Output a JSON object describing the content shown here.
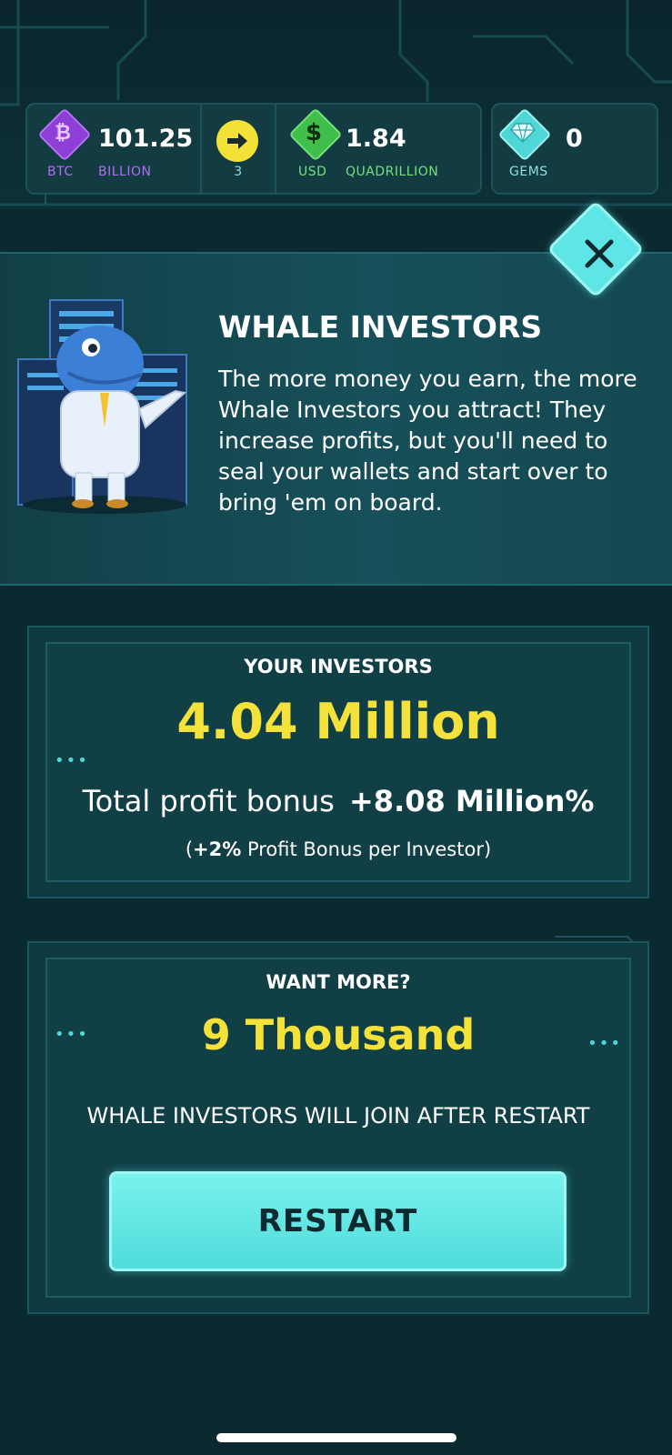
{
  "currency_bar": {
    "btc": {
      "amount": "101.25",
      "code": "BTC",
      "unit": "BILLION",
      "icon": "bitcoin-icon",
      "color": "#8e3fd8"
    },
    "boost": {
      "count": "3",
      "icon": "arrow-right-icon",
      "color": "#f2e238"
    },
    "usd": {
      "amount": "1.84",
      "code": "USD",
      "unit": "QUADRILLION",
      "icon": "dollar-icon",
      "color": "#3fbf4a"
    },
    "gems": {
      "amount": "0",
      "code": "GEMS",
      "icon": "gem-icon",
      "color": "#4fd6d6"
    }
  },
  "info_panel": {
    "title": "WHALE INVESTORS",
    "description": "The more money you earn, the more Whale Investors you attract! They increase profits, but you'll need to seal your wallets and start over to bring 'em on board.",
    "close_icon": "close-icon"
  },
  "your_investors": {
    "label": "YOUR INVESTORS",
    "count": "4.04 Million",
    "bonus_label": "Total profit bonus",
    "bonus_value": "+8.08 Million%",
    "per_investor_bonus": "+2%",
    "per_investor_text": "Profit Bonus per Investor"
  },
  "want_more": {
    "label": "WANT MORE?",
    "count": "9 Thousand",
    "note": "WHALE INVESTORS WILL JOIN AFTER RESTART",
    "restart_label": "RESTART"
  },
  "colors": {
    "background": "#0b2a30",
    "accent": "#5ee6e6",
    "highlight": "#f4e23a"
  }
}
